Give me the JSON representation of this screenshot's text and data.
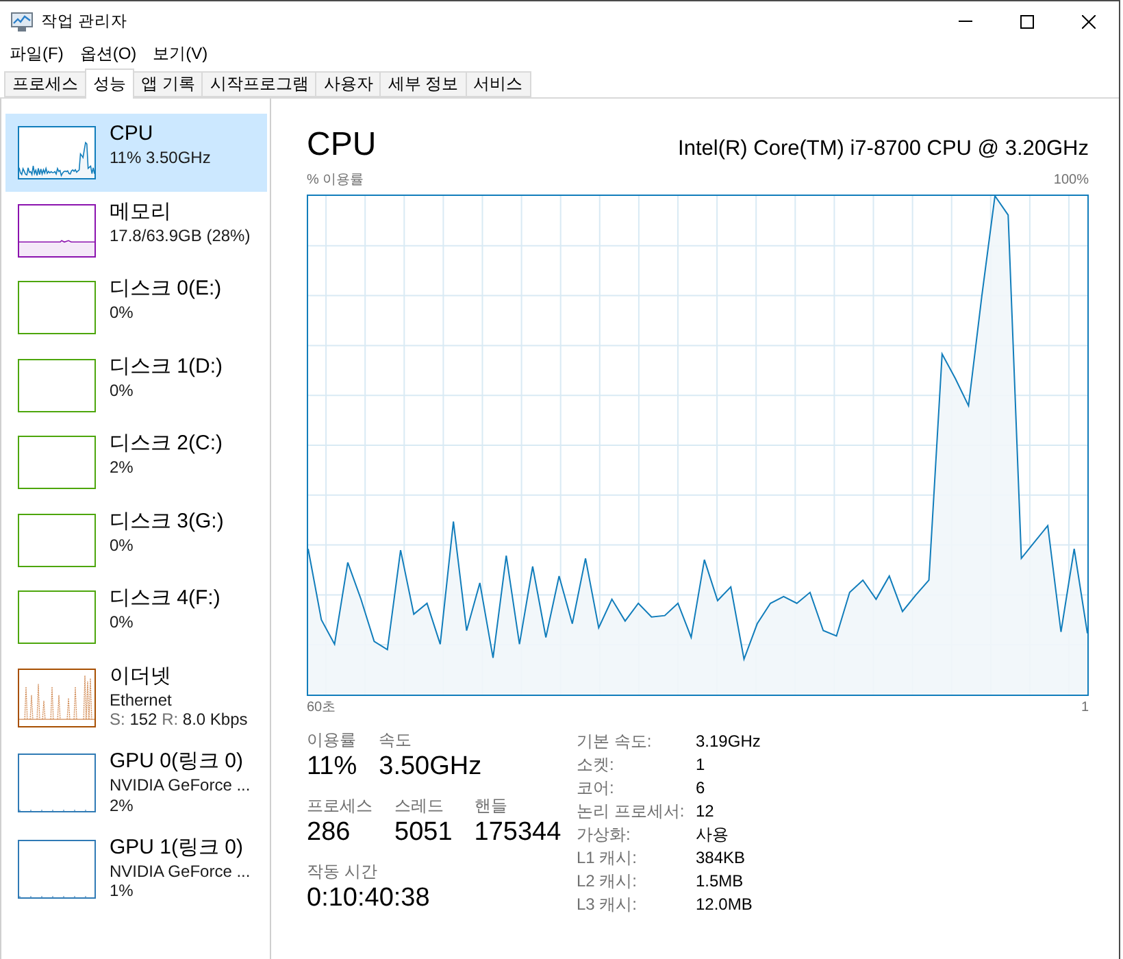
{
  "window": {
    "title": "작업 관리자"
  },
  "menu_bar": [
    "파일(F)",
    "옵션(O)",
    "보기(V)"
  ],
  "tabs": [
    {
      "label": "프로세스",
      "selected": false
    },
    {
      "label": "성능",
      "selected": true
    },
    {
      "label": "앱 기록",
      "selected": false
    },
    {
      "label": "시작프로그램",
      "selected": false
    },
    {
      "label": "사용자",
      "selected": false
    },
    {
      "label": "세부 정보",
      "selected": false
    },
    {
      "label": "서비스",
      "selected": false
    }
  ],
  "sidebar": {
    "items": [
      {
        "kind": "cpu",
        "name": "CPU",
        "details": [
          "11% 3.50GHz"
        ],
        "selected": true
      },
      {
        "kind": "memory",
        "name": "메모리",
        "details": [
          "17.8/63.9GB (28%)"
        ],
        "selected": false
      },
      {
        "kind": "disk",
        "name": "디스크 0(E:)",
        "details": [
          "0%"
        ],
        "selected": false
      },
      {
        "kind": "disk",
        "name": "디스크 1(D:)",
        "details": [
          "0%"
        ],
        "selected": false
      },
      {
        "kind": "disk",
        "name": "디스크 2(C:)",
        "details": [
          "2%"
        ],
        "selected": false
      },
      {
        "kind": "disk",
        "name": "디스크 3(G:)",
        "details": [
          "0%"
        ],
        "selected": false
      },
      {
        "kind": "disk",
        "name": "디스크 4(F:)",
        "details": [
          "0%"
        ],
        "selected": false
      },
      {
        "kind": "network",
        "name": "이더넷",
        "details": [
          "Ethernet"
        ],
        "rates": [
          {
            "label": "S:",
            "value": "152"
          },
          {
            "label": "R:",
            "value": "8.0 Kbps"
          }
        ],
        "selected": false
      },
      {
        "kind": "gpu",
        "name": "GPU 0(링크 0)",
        "details": [
          "NVIDIA GeForce ...",
          "2%"
        ],
        "selected": false
      },
      {
        "kind": "gpu",
        "name": "GPU 1(링크 0)",
        "details": [
          "NVIDIA GeForce ...",
          "1%"
        ],
        "selected": false
      }
    ]
  },
  "detail": {
    "title": "CPU",
    "processor": "Intel(R) Core(TM) i7-8700 CPU @ 3.20GHz",
    "graph": {
      "y_label": "% 이용률",
      "y_max": "100%",
      "x_start": "60초",
      "x_end": "1"
    },
    "stat_rows": [
      {
        "stats": [
          {
            "label": "이용률",
            "value": "11%"
          },
          {
            "label": "속도",
            "value": "3.50GHz"
          }
        ]
      },
      {
        "stats": [
          {
            "label": "프로세스",
            "value": "286"
          },
          {
            "label": "스레드",
            "value": "5051"
          },
          {
            "label": "핸들",
            "value": "175344"
          }
        ]
      },
      {
        "stats": [
          {
            "label": "작동 시간",
            "value": "0:10:40:38"
          }
        ]
      }
    ],
    "specs": [
      {
        "label": "기본 속도:",
        "value": "3.19GHz"
      },
      {
        "label": "소켓:",
        "value": "1"
      },
      {
        "label": "코어:",
        "value": "6"
      },
      {
        "label": "논리 프로세서:",
        "value": "12"
      },
      {
        "label": "가상화:",
        "value": "사용"
      },
      {
        "label": "L1 캐시:",
        "value": "384KB"
      },
      {
        "label": "L2 캐시:",
        "value": "1.5MB"
      },
      {
        "label": "L3 캐시:",
        "value": "12.0MB"
      }
    ]
  }
}
